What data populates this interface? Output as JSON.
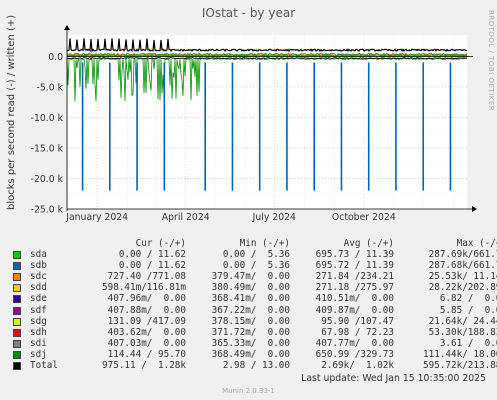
{
  "title": "IOstat - by year",
  "side_text": "RRDTOOL / TOBI OETIKER",
  "footer": {
    "last_update": "Last update:  Wed Jan 15 10:35:00 2025",
    "version": "Munin 2.0.33-1"
  },
  "chart_data": {
    "type": "line",
    "title": "IOstat - by year",
    "ylabel": "blocks per second read (-) / written (+)",
    "ylim": [
      -25000,
      3500
    ],
    "yticks": [
      {
        "value": 0,
        "label": "0.0"
      },
      {
        "value": -5000,
        "label": "-5.0 k"
      },
      {
        "value": -10000,
        "label": "-10.0 k"
      },
      {
        "value": -15000,
        "label": "-15.0 k"
      },
      {
        "value": -20000,
        "label": "-20.0 k"
      },
      {
        "value": -25000,
        "label": "-25.0 k"
      }
    ],
    "xlim": [
      "2023-12-01",
      "2025-01-15"
    ],
    "xticks": [
      {
        "value": "2024-01-01",
        "label": "January 2024"
      },
      {
        "value": "2024-04-01",
        "label": "April 2024"
      },
      {
        "value": "2024-07-01",
        "label": "July 2024"
      },
      {
        "value": "2024-10-01",
        "label": "October 2024"
      }
    ],
    "grid": true,
    "columns": [
      "Cur (-/+)",
      "Min (-/+)",
      "Avg (-/+)",
      "Max (-/+)"
    ],
    "series": [
      {
        "name": "sda",
        "color": "#00cc00",
        "cur": "0.00 / 11.62",
        "min": "0.00 /  5.36",
        "avg": "695.73 / 11.39",
        "max": "287.69k/661.70"
      },
      {
        "name": "sdb",
        "color": "#0066b3",
        "cur": "0.00 / 11.62",
        "min": "0.00 /  5.36",
        "avg": "695.72 / 11.39",
        "max": "287.68k/661.70"
      },
      {
        "name": "sdc",
        "color": "#ff8000",
        "cur": "727.40 /771.08",
        "min": "379.47m/  0.00",
        "avg": "271.84 /234.21",
        "max": "25.53k/ 11.14k"
      },
      {
        "name": "sdd",
        "color": "#ffcc00",
        "cur": "598.41m/116.81m",
        "min": "380.49m/  0.00",
        "avg": "271.18 /275.97",
        "max": "28.22k/202.89k"
      },
      {
        "name": "sde",
        "color": "#330099",
        "cur": "407.96m/  0.00",
        "min": "368.41m/  0.00",
        "avg": "410.51m/  0.00",
        "max": "6.82 /  0.00"
      },
      {
        "name": "sdf",
        "color": "#990099",
        "cur": "407.88m/  0.00",
        "min": "367.22m/  0.00",
        "avg": "409.87m/  0.00",
        "max": "5.85 /  0.00"
      },
      {
        "name": "sdg",
        "color": "#ccff00",
        "cur": "131.09 /417.09",
        "min": "378.15m/  0.00",
        "avg": "95.90 /107.47",
        "max": "21.64k/ 24.44k"
      },
      {
        "name": "sdh",
        "color": "#ff0000",
        "cur": "403.62m/  0.00",
        "min": "371.72m/  0.00",
        "avg": "67.98 / 72.23",
        "max": "53.30k/188.83k"
      },
      {
        "name": "sdi",
        "color": "#808080",
        "cur": "407.03m/  0.00",
        "min": "365.33m/  0.00",
        "avg": "407.77m/  0.00",
        "max": "3.61 /  0.00"
      },
      {
        "name": "sdj",
        "color": "#008f00",
        "cur": "114.44 / 95.70",
        "min": "368.49m/  0.00",
        "avg": "650.99 /329.73",
        "max": "111.44k/ 18.06k"
      },
      {
        "name": "Total",
        "color": "#000000",
        "cur": "975.11 /  1.28k",
        "min": "2.98 / 13.00",
        "avg": "2.69k/  1.02k",
        "max": "595.72k/213.88k"
      }
    ]
  }
}
